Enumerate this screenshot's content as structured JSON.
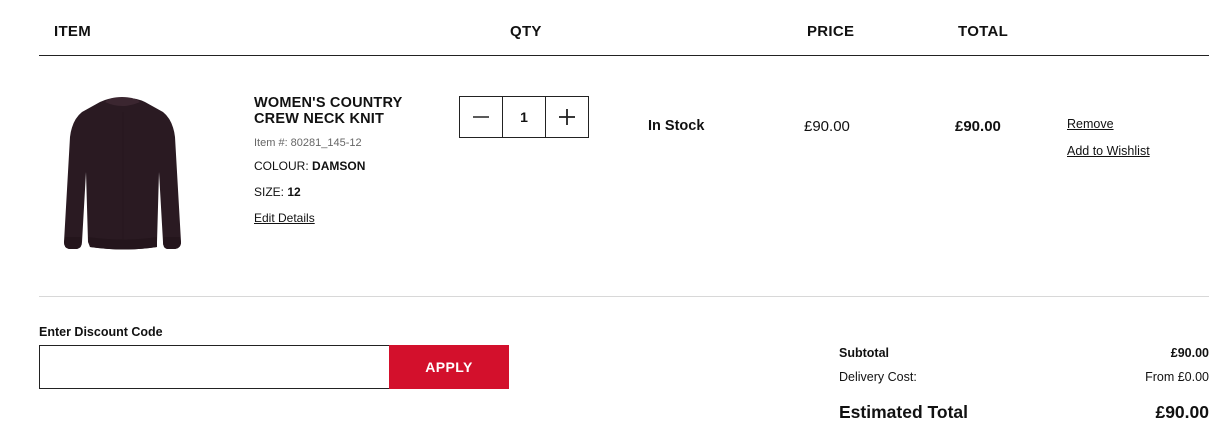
{
  "headers": {
    "item": "ITEM",
    "qty": "QTY",
    "price": "PRICE",
    "total": "TOTAL"
  },
  "product": {
    "name": "WOMEN'S COUNTRY CREW NECK KNIT",
    "item_number": "Item #: 80281_145-12",
    "colour_label": "COLOUR:",
    "colour_value": "DAMSON",
    "size_label": "SIZE:",
    "size_value": "12",
    "edit_label": "Edit Details",
    "image_icon": "sweater-image",
    "image_color": "#2a1a22"
  },
  "qty": {
    "value": "1",
    "minus": "—",
    "plus": "+"
  },
  "stock": "In Stock",
  "price": "£90.00",
  "total": "£90.00",
  "actions": {
    "remove": "Remove",
    "wishlist": "Add to Wishlist"
  },
  "discount": {
    "label": "Enter Discount Code",
    "value": "",
    "placeholder": "",
    "apply": "APPLY"
  },
  "summary": {
    "subtotal_label": "Subtotal",
    "subtotal_value": "£90.00",
    "delivery_label": "Delivery Cost:",
    "delivery_value": "From £0.00",
    "estimated_label": "Estimated Total",
    "estimated_value": "£90.00"
  },
  "colors": {
    "accent": "#d3102c",
    "text": "#111111",
    "divider": "#d8d8d8"
  }
}
